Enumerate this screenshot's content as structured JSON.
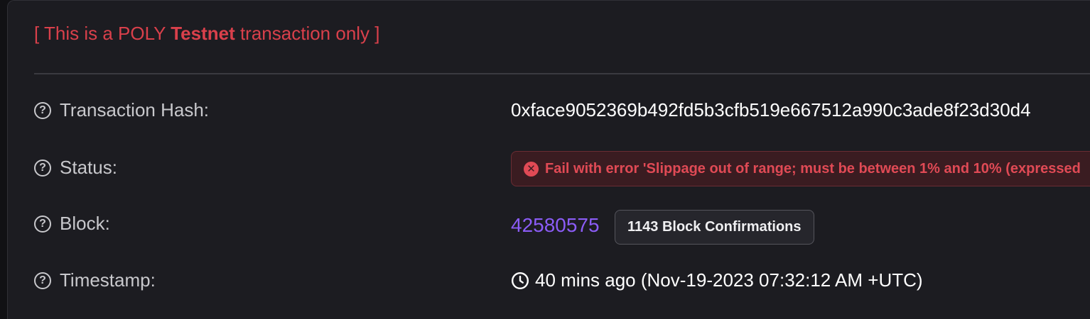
{
  "notice": {
    "prefix": "[ This is a POLY ",
    "highlight": "Testnet",
    "suffix": " transaction only ]",
    "color": "#d9404b"
  },
  "fields": {
    "hash": {
      "label": "Transaction Hash:",
      "value": "0xface9052369b492fd5b3cfb519e667512a990c3ade8f23d30d4"
    },
    "status": {
      "label": "Status:",
      "value": "Fail with error 'Slippage out of range; must be between 1% and 10% (expressed",
      "icon": "x-circle-icon",
      "color": "#e04a55"
    },
    "block": {
      "label": "Block:",
      "number": "42580575",
      "confirmations": "1143 Block Confirmations",
      "link_color": "#8b5cf6"
    },
    "timestamp": {
      "label": "Timestamp:",
      "value": "40 mins ago (Nov-19-2023 07:32:12 AM +UTC)",
      "icon": "clock-icon"
    }
  },
  "icons": {
    "help": "question-circle-icon",
    "help_glyph": "?",
    "fail_glyph": "✕"
  }
}
